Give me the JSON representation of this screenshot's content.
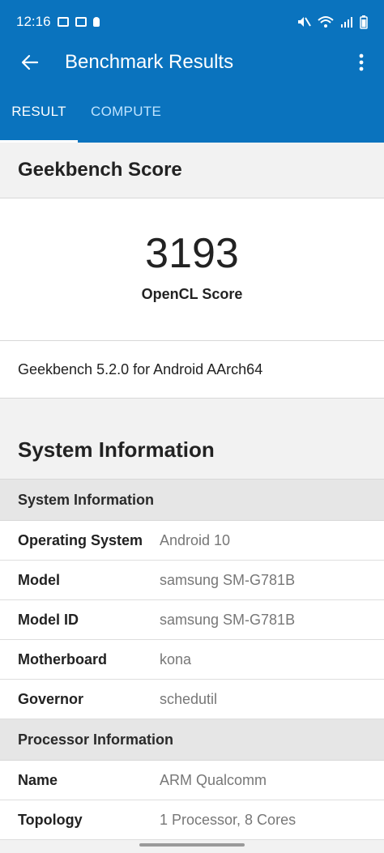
{
  "status_bar": {
    "time": "12:16"
  },
  "app_bar": {
    "title": "Benchmark Results"
  },
  "tabs": [
    {
      "label": "RESULT",
      "active": true
    },
    {
      "label": "COMPUTE",
      "active": false
    }
  ],
  "score_section": {
    "heading": "Geekbench Score",
    "score": "3193",
    "score_label": "OpenCL Score",
    "version": "Geekbench 5.2.0 for Android AArch64"
  },
  "system_information": {
    "title": "System Information",
    "groups": [
      {
        "heading": "System Information",
        "rows": [
          {
            "key": "Operating System",
            "value": "Android 10"
          },
          {
            "key": "Model",
            "value": "samsung SM-G781B"
          },
          {
            "key": "Model ID",
            "value": "samsung SM-G781B"
          },
          {
            "key": "Motherboard",
            "value": "kona"
          },
          {
            "key": "Governor",
            "value": "schedutil"
          }
        ]
      },
      {
        "heading": "Processor Information",
        "rows": [
          {
            "key": "Name",
            "value": "ARM Qualcomm"
          },
          {
            "key": "Topology",
            "value": "1 Processor, 8 Cores"
          }
        ]
      }
    ]
  },
  "colors": {
    "primary": "#0a73be",
    "inactive_tab": "#bfe4ff"
  }
}
